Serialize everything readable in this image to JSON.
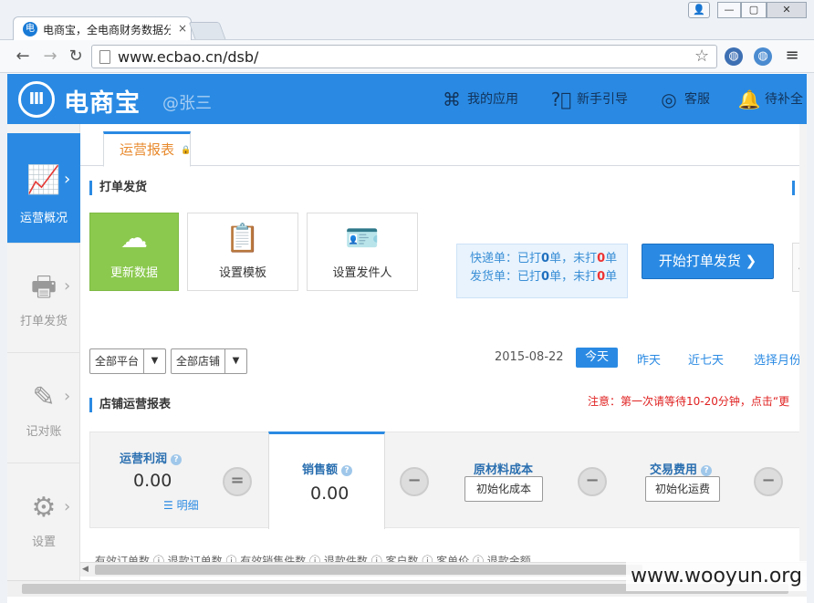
{
  "browser": {
    "tab_title": "电商宝，全电商财务数据分",
    "tab_icon": "电",
    "tab_close": "×",
    "url": "www.ecbao.cn/dsb/",
    "win_user": "👤",
    "win_min": "—",
    "win_max": "▢",
    "win_close": "✕"
  },
  "header": {
    "logo_mark": "Ⅲ",
    "logo_text": "电商宝",
    "username": "@张三",
    "nav": [
      {
        "label": "我的应用",
        "icon": "apps-icon"
      },
      {
        "label": "新手引导",
        "icon": "help-icon"
      },
      {
        "label": "客服",
        "icon": "headset-icon"
      },
      {
        "label": "待补全",
        "icon": "bell-icon"
      }
    ]
  },
  "sidebar": {
    "items": [
      {
        "label": "运营概况",
        "icon": "chart-line-icon",
        "active": true
      },
      {
        "label": "打单发货",
        "icon": "printer-icon"
      },
      {
        "label": "记对账",
        "icon": "edit-icon"
      },
      {
        "label": "设置",
        "icon": "gear-icon"
      }
    ]
  },
  "content": {
    "active_tab": "运营报表",
    "print_section": {
      "title": "打单发货",
      "cards": [
        {
          "label": "更新数据",
          "icon": "cloud-refresh-icon"
        },
        {
          "label": "设置模板",
          "icon": "clipboard-icon"
        },
        {
          "label": "设置发件人",
          "icon": "id-card-icon"
        }
      ],
      "express_prefix": "快递单：已打",
      "express_printed": "0",
      "express_mid": "单，未打",
      "express_unprinted": "0",
      "express_suffix": "单",
      "ship_prefix": "发货单：已打",
      "ship_printed": "0",
      "ship_mid": "单，未打",
      "ship_unprinted": "0",
      "ship_suffix": "单",
      "start_button": "开始打单发货"
    },
    "filters": {
      "platform": "全部平台",
      "shop": "全部店铺",
      "date": "2015-08-22",
      "today": "今天",
      "yesterday": "昨天",
      "last7": "近七天",
      "month": "选择月份"
    },
    "shop_report": {
      "title": "店铺运营报表",
      "notice": "注意：第一次请等待10-20分钟，点击“更"
    },
    "stats": {
      "profit_label": "运营利润",
      "profit_value": "0.00",
      "detail_link": "☰ 明细",
      "sales_label": "销售额",
      "sales_value": "0.00",
      "material_label": "原材料成本",
      "init_cost_button": "初始化成本",
      "fee_label": "交易费用",
      "init_fee_button": "初始化运费"
    },
    "bottom_row": "有效订单数 ⓘ   退款订单数 ⓘ   有效销售件数 ⓘ   退款件数 ⓘ   客户数 ⓘ   客单价 ⓘ   退款金额"
  },
  "watermark": "www.wooyun.org",
  "colors": {
    "brand": "#2a8ae3",
    "green": "#8bc94e",
    "alert": "#e02020"
  }
}
